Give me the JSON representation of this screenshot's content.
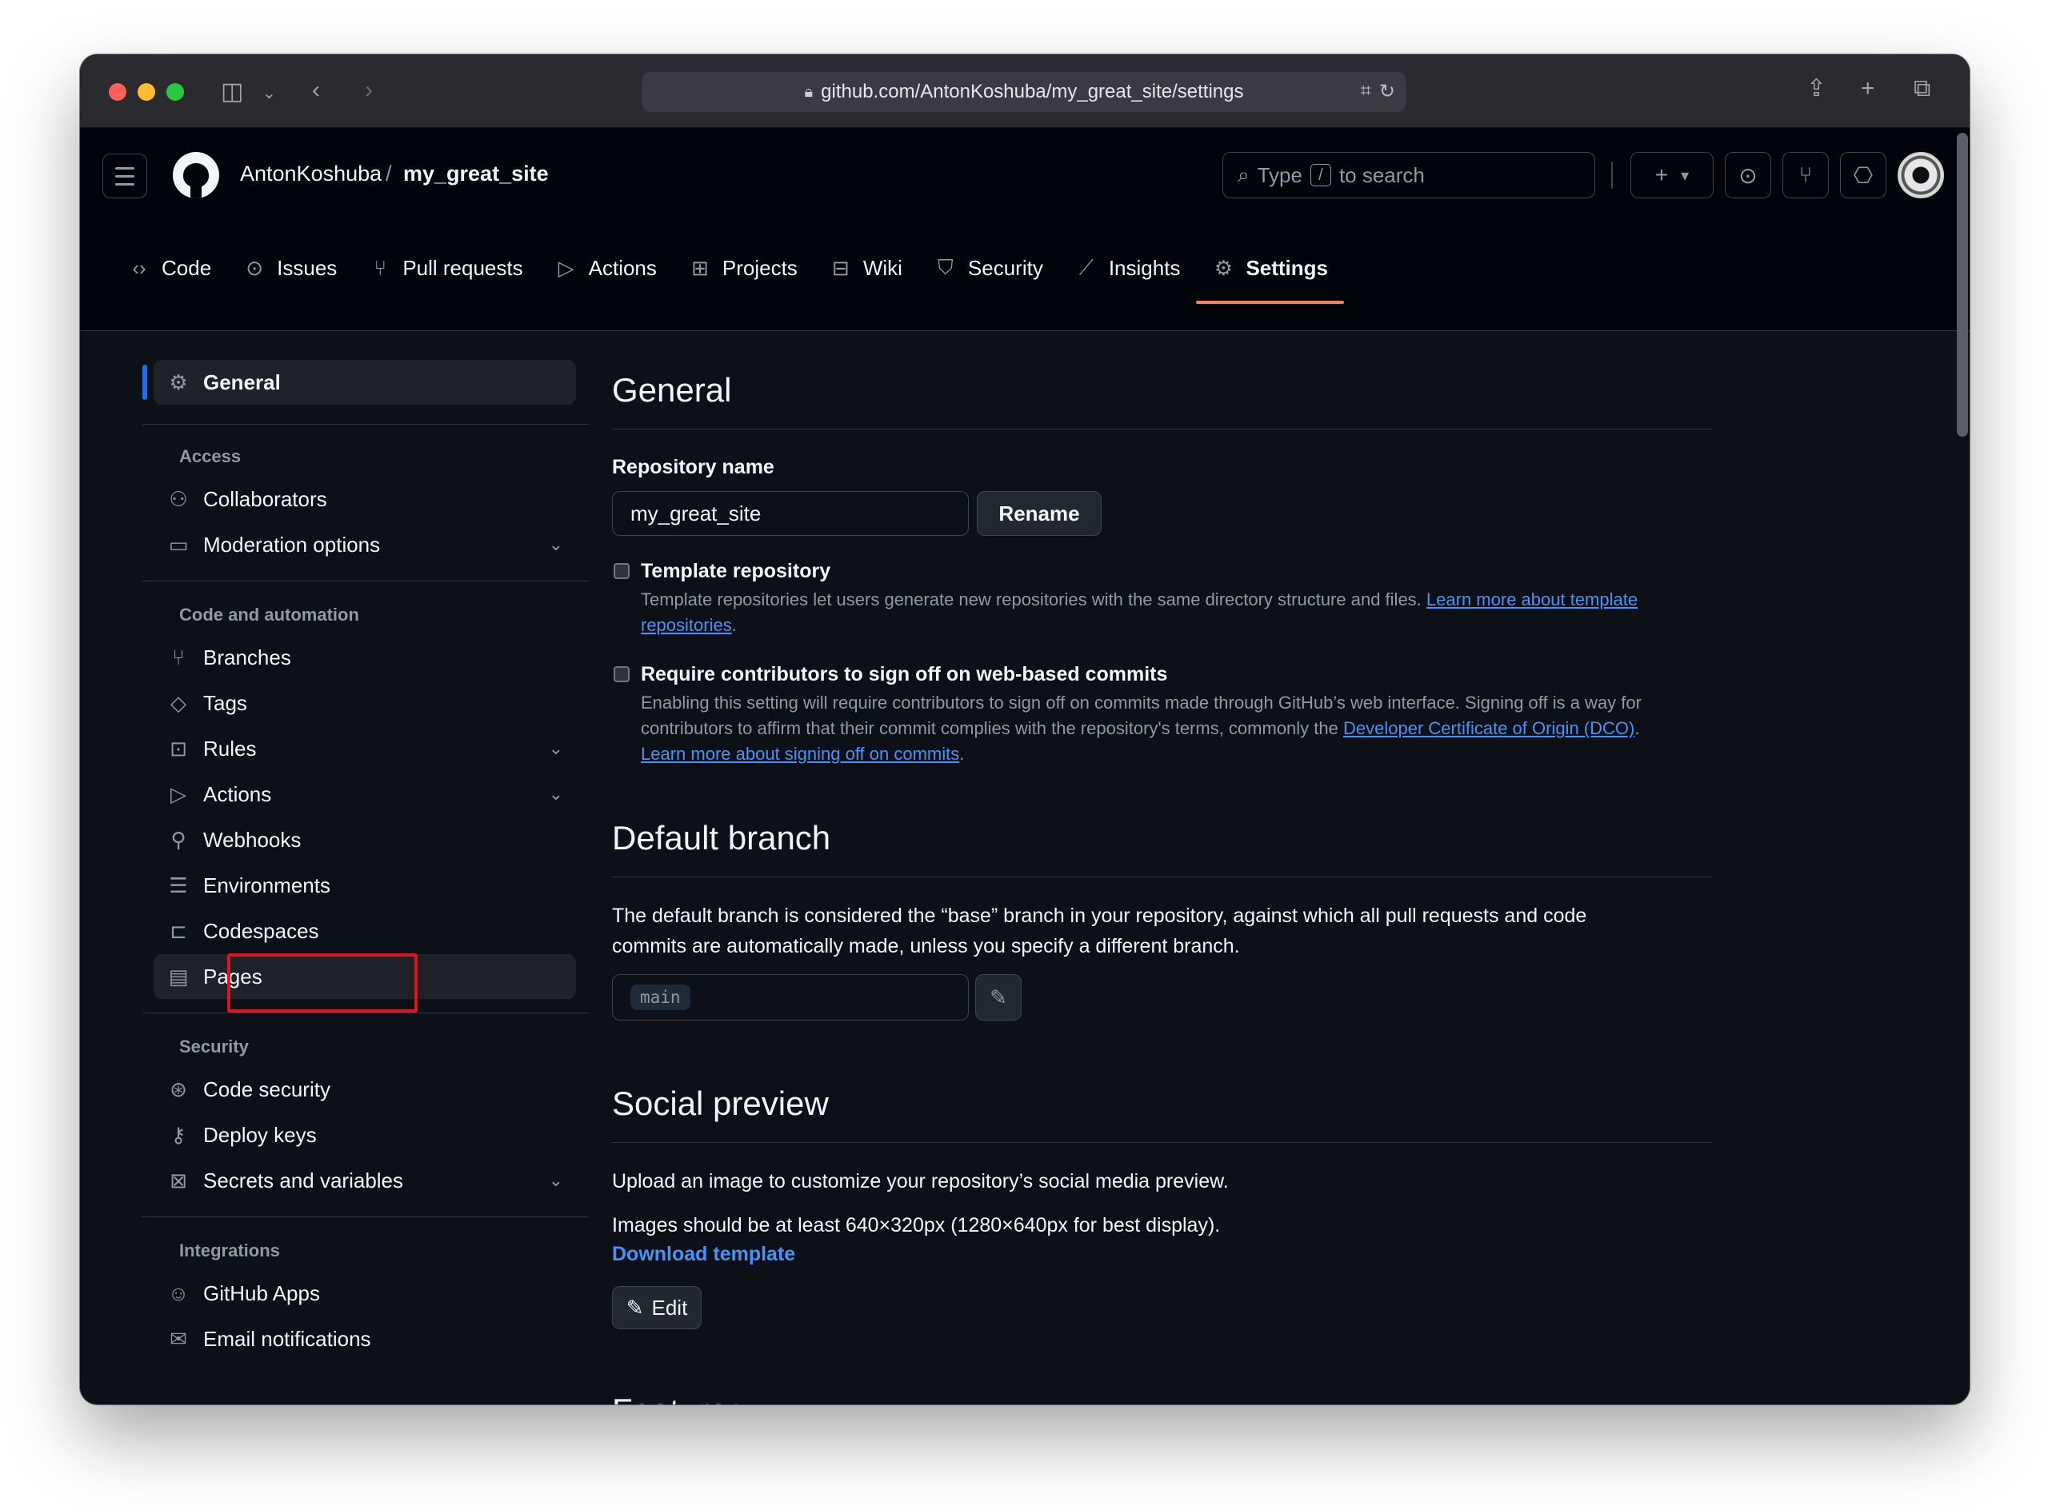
{
  "browser": {
    "url": "github.com/AntonKoshuba/my_great_site/settings",
    "icons": [
      "sidebar-toggle-icon",
      "chevron-down-icon",
      "back-icon",
      "forward-icon",
      "lock-icon",
      "translate-icon",
      "reload-icon",
      "share-icon",
      "new-tab-icon",
      "tab-overview-icon"
    ]
  },
  "header": {
    "owner": "AntonKoshuba",
    "separator": "/",
    "repo": "my_great_site",
    "search_prefix": "Type",
    "search_key": "/",
    "search_suffix": "to search",
    "plus_label": "+",
    "plus_caret": "▾"
  },
  "tabs": [
    {
      "label": "Code",
      "icon": "code-icon"
    },
    {
      "label": "Issues",
      "icon": "issue-icon"
    },
    {
      "label": "Pull requests",
      "icon": "pull-request-icon"
    },
    {
      "label": "Actions",
      "icon": "play-icon"
    },
    {
      "label": "Projects",
      "icon": "table-icon"
    },
    {
      "label": "Wiki",
      "icon": "book-icon"
    },
    {
      "label": "Security",
      "icon": "shield-icon"
    },
    {
      "label": "Insights",
      "icon": "graph-icon"
    },
    {
      "label": "Settings",
      "icon": "gear-icon",
      "active": true
    }
  ],
  "sidebar": {
    "general": "General",
    "access_heading": "Access",
    "collaborators": "Collaborators",
    "moderation": "Moderation options",
    "code_heading": "Code and automation",
    "branches": "Branches",
    "tags": "Tags",
    "rules": "Rules",
    "actions": "Actions",
    "webhooks": "Webhooks",
    "environments": "Environments",
    "codespaces": "Codespaces",
    "pages": "Pages",
    "security_heading": "Security",
    "code_security": "Code security",
    "deploy_keys": "Deploy keys",
    "secrets": "Secrets and variables",
    "integrations_heading": "Integrations",
    "github_apps": "GitHub Apps",
    "email_notifications": "Email notifications"
  },
  "main": {
    "general_title": "General",
    "repo_name_label": "Repository name",
    "repo_name_value": "my_great_site",
    "rename_button": "Rename",
    "template_title": "Template repository",
    "template_desc": "Template repositories let users generate new repositories with the same directory structure and files.",
    "template_link_1": "Learn more about template",
    "template_link_2": "repositories",
    "template_end": ".",
    "signoff_title": "Require contributors to sign off on web-based commits",
    "signoff_desc_1": "Enabling this setting will require contributors to sign off on commits made through GitHub’s web interface. Signing off is a way for",
    "signoff_desc_2": "contributors to affirm that their commit complies with the repository's terms, commonly the",
    "signoff_link_dco": "Developer Certificate of Origin (DCO)",
    "signoff_end_1": ".",
    "signoff_link_learn": "Learn more about signing off on commits",
    "signoff_end_2": ".",
    "default_branch_title": "Default branch",
    "default_branch_desc_1": "The default branch is considered the “base” branch in your repository, against which all pull requests and code",
    "default_branch_desc_2": "commits are automatically made, unless you specify a different branch.",
    "default_branch_value": "main",
    "social_title": "Social preview",
    "social_desc": "Upload an image to customize your repository’s social media preview.",
    "social_size": "Images should be at least 640×320px (1280×640px for best display).",
    "download_template": "Download template",
    "edit_button": "Edit",
    "features_title": "Features"
  },
  "colors": {
    "background": "#0d1117",
    "header": "#010409",
    "accent_tab": "#f78166",
    "link": "#4493f8",
    "highlight_box": "#e0141e"
  }
}
